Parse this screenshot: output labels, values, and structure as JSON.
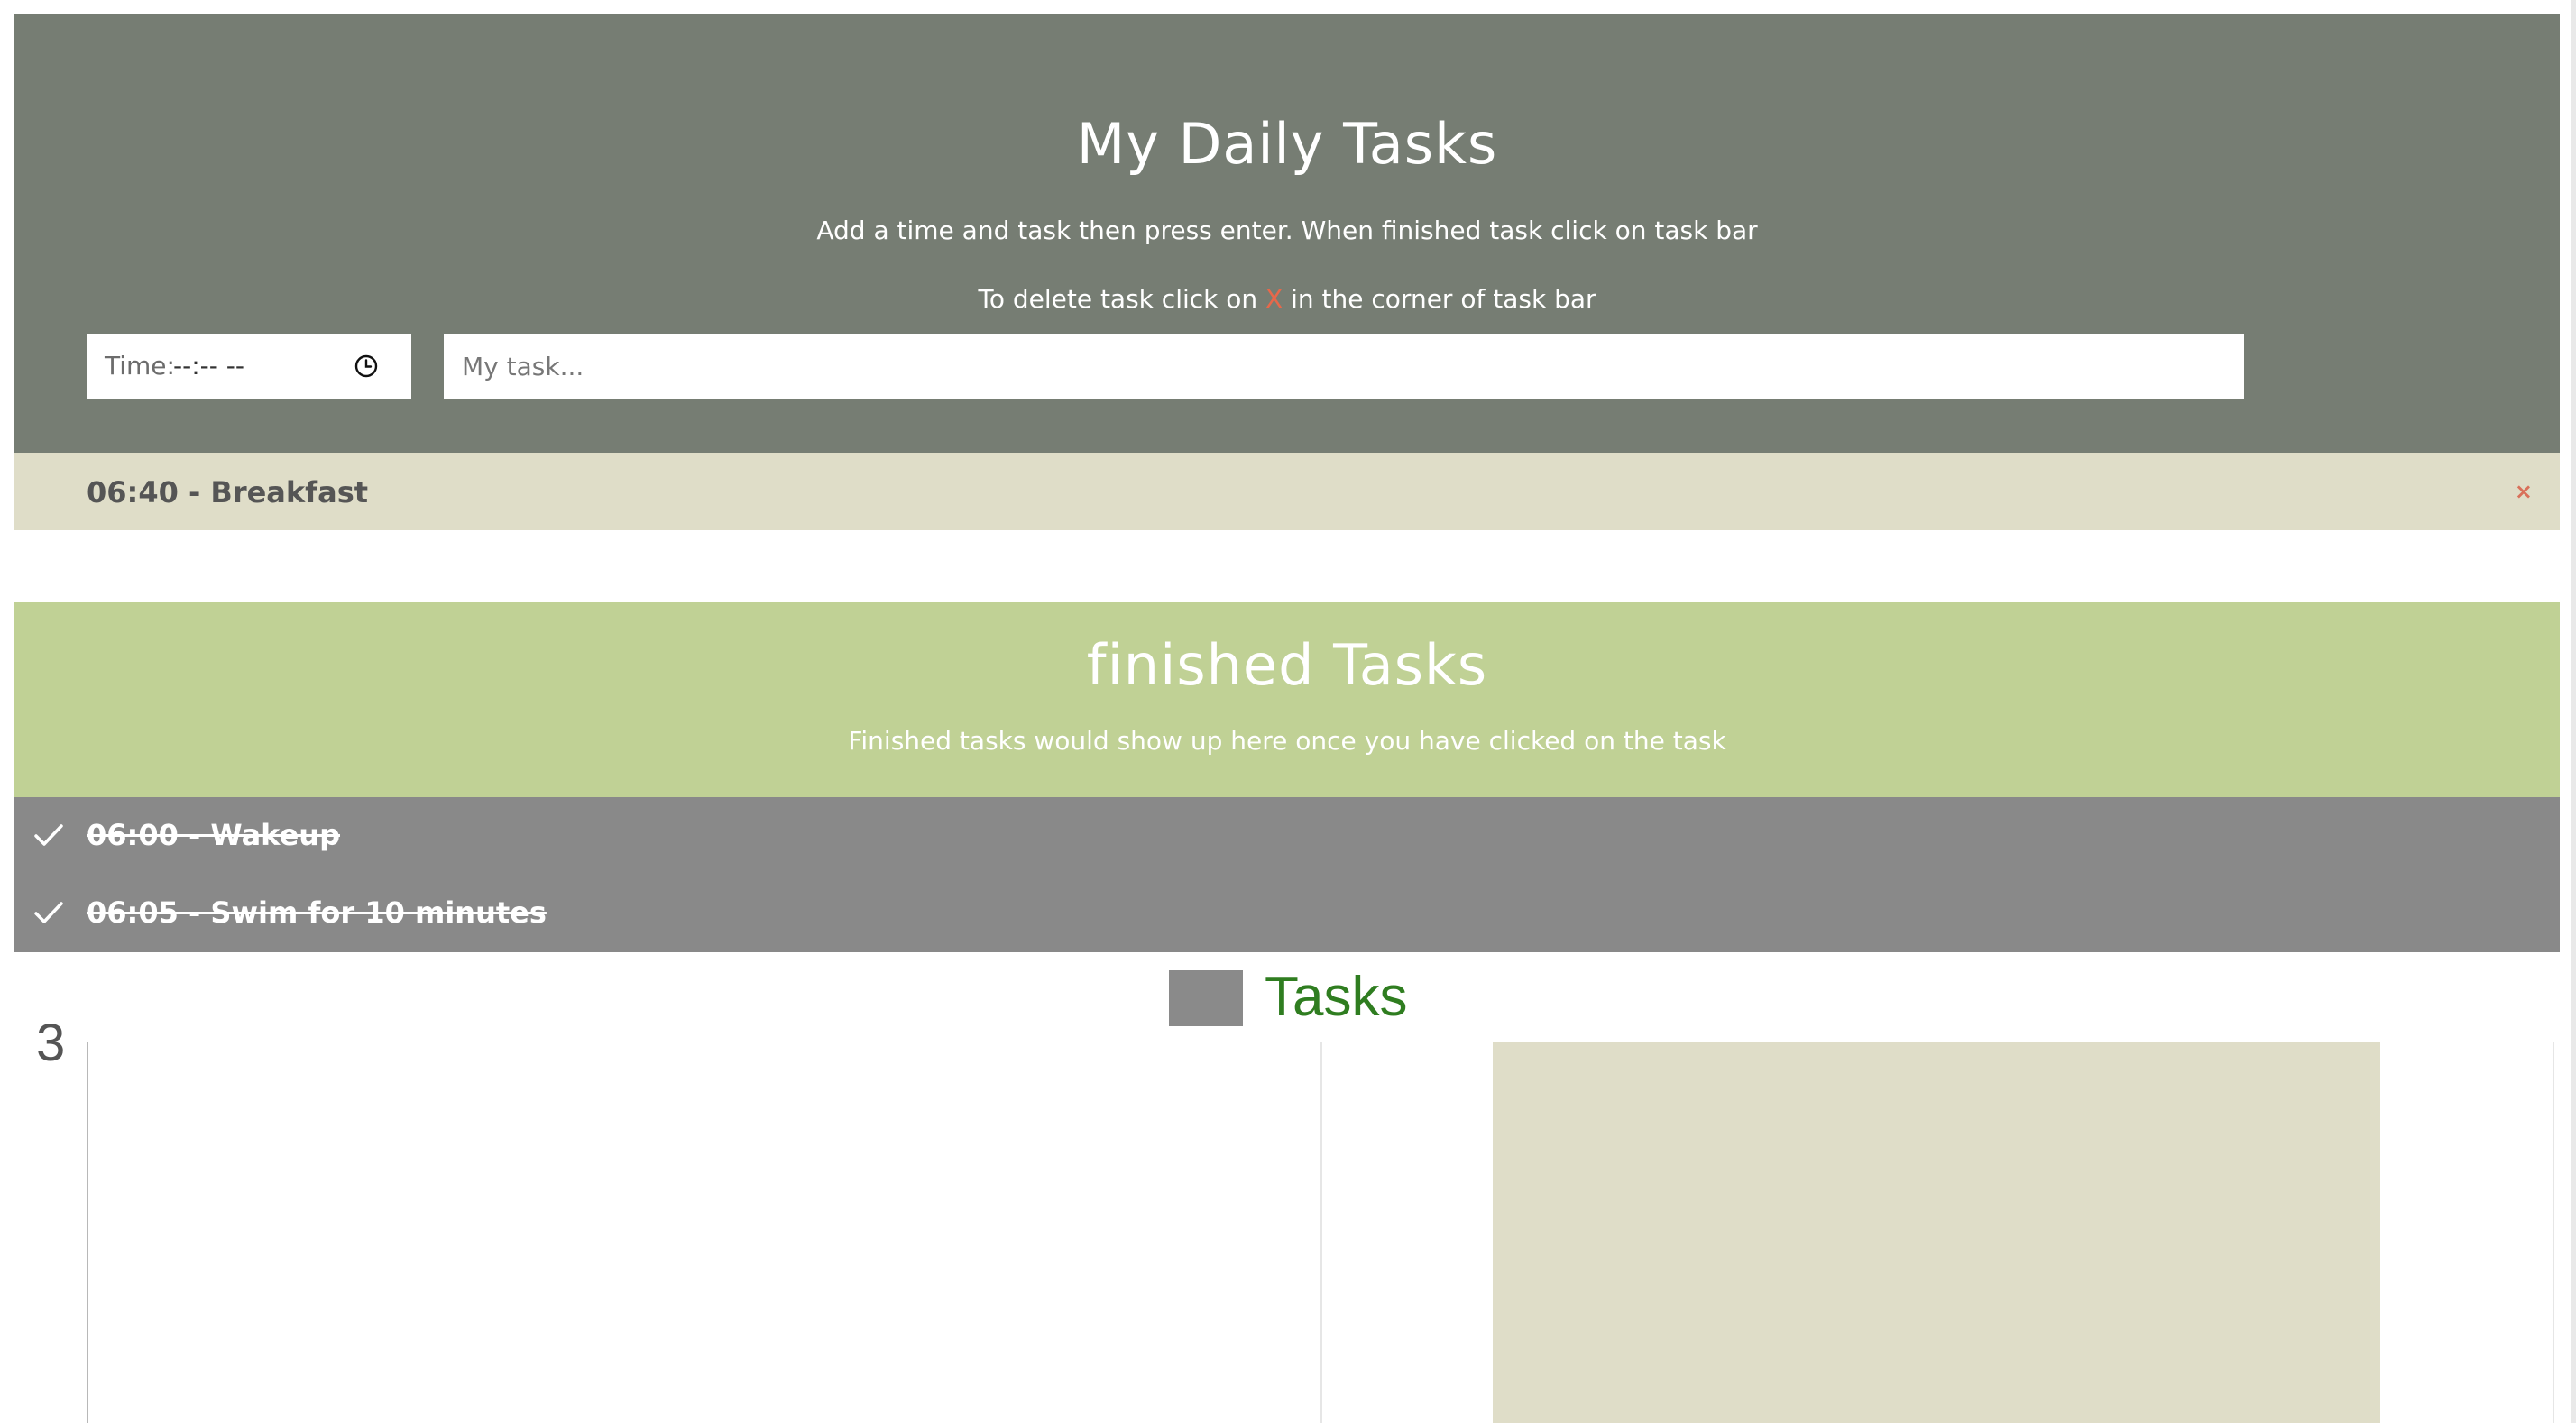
{
  "header": {
    "title": "My Daily Tasks",
    "instructions": "Add a time and task then press enter. When finished task click on task bar",
    "delete_prefix": "To delete task click on ",
    "delete_mark": "X",
    "delete_suffix": " in the corner of task bar",
    "time_label": "Time:",
    "time_value": "--:-- --",
    "time_icon": "clock-icon",
    "task_placeholder": "My task..."
  },
  "pending_tasks": [
    {
      "label": "06:40 - Breakfast",
      "delete_icon": "×"
    }
  ],
  "finished": {
    "title": "finished Tasks",
    "subtitle": "Finished tasks would show up here once you have clicked on the task",
    "items": [
      {
        "label": "06:00 - Wakeup",
        "icon": "check-icon"
      },
      {
        "label": "06:05 - Swim for 10 minutes",
        "icon": "check-icon"
      }
    ]
  },
  "colors": {
    "header_bg": "#767d73",
    "pending_bg": "#dfddc8",
    "finished_header_bg": "#c0d195",
    "finished_list_bg": "#898989",
    "delete_accent": "#e8684a",
    "legend_text": "#2f7d20"
  },
  "chart_data": {
    "type": "bar",
    "legend": [
      "Tasks"
    ],
    "legend_swatch_color": "#8a8a8a",
    "y_tick_visible": "3",
    "series": [
      {
        "name": "Tasks",
        "values": [
          0,
          3
        ],
        "colors": [
          "#8a8a8a",
          "#dfddc8"
        ]
      }
    ],
    "categories": [
      "",
      ""
    ],
    "ylim": [
      0,
      3
    ]
  }
}
